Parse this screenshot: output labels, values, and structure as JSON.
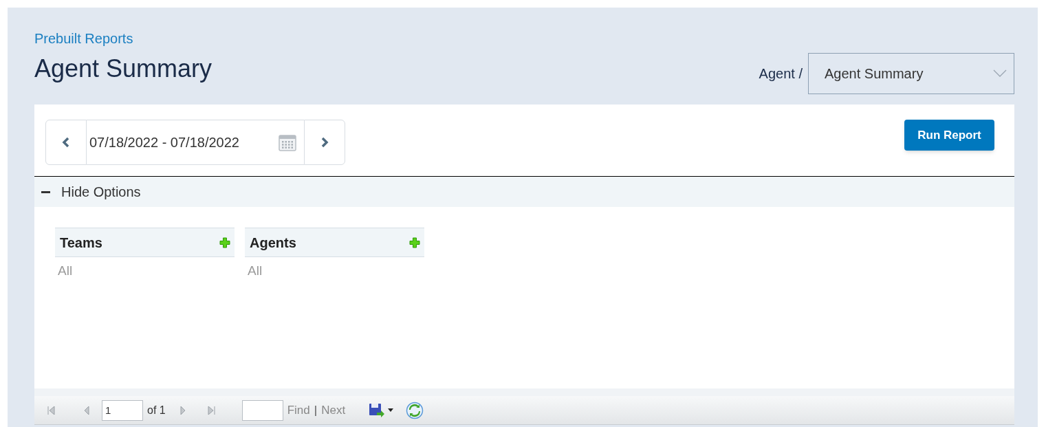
{
  "breadcrumb": "Prebuilt Reports",
  "title": "Agent Summary",
  "report_selector": {
    "category": "Agent /",
    "value": "Agent Summary"
  },
  "date_range": {
    "value": "07/18/2022 - 07/18/2022"
  },
  "run_button": "Run Report",
  "options": {
    "label": "Hide Options",
    "expanded": true,
    "filters": [
      {
        "title": "Teams",
        "value": "All"
      },
      {
        "title": "Agents",
        "value": "All"
      }
    ]
  },
  "report_toolbar": {
    "page": "1",
    "page_count": "of 1",
    "find": "Find",
    "separator": "|",
    "next": "Next"
  }
}
